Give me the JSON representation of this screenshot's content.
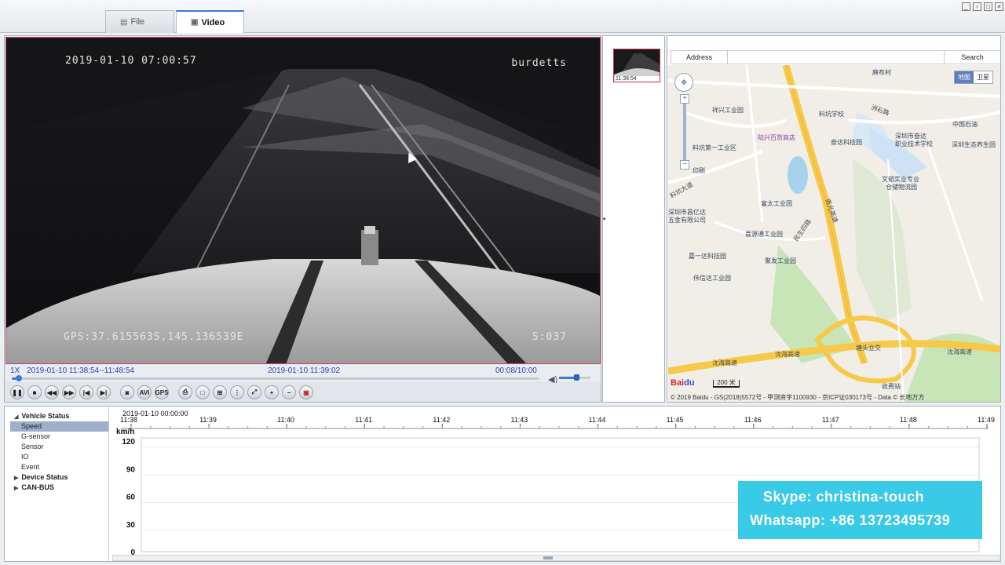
{
  "tabs": [
    {
      "label": "File",
      "icon": "file-icon"
    },
    {
      "label": "Video",
      "icon": "video-icon"
    }
  ],
  "window_controls": [
    "minimize-icon",
    "restore-icon",
    "maximize-icon",
    "close-icon"
  ],
  "video": {
    "osd_datetime": "2019-01-10 07:00:57",
    "osd_name": "burdetts",
    "osd_gps": "GPS:37.615563S,145.136539E",
    "osd_speed": "S:037",
    "playback_speed": "1X",
    "range": "2019-01-10 11:38:54--11:48:54",
    "current_time": "2019-01-10 11:39:02",
    "position": "00:08/10:00",
    "progress_fraction": 0.013,
    "volume_fraction": 0.55
  },
  "controls": [
    {
      "icon": "pause-icon",
      "glyph": "❚❚"
    },
    {
      "icon": "stop-icon",
      "glyph": "■"
    },
    {
      "icon": "rewind-icon",
      "glyph": "◀◀"
    },
    {
      "icon": "fast-forward-icon",
      "glyph": "▶▶"
    },
    {
      "icon": "previous-icon",
      "glyph": "|◀"
    },
    {
      "icon": "next-icon",
      "glyph": "▶|"
    },
    {
      "icon": "snapshot-icon",
      "glyph": "◙"
    },
    {
      "icon": "avi-icon",
      "glyph": "AVI"
    },
    {
      "icon": "gps-icon",
      "glyph": "GPS"
    },
    {
      "icon": "print-icon",
      "glyph": "⎙"
    },
    {
      "icon": "single-view-icon",
      "glyph": "□"
    },
    {
      "icon": "quad-view-icon",
      "glyph": "⊞"
    },
    {
      "icon": "nine-view-icon",
      "glyph": "⋮"
    },
    {
      "icon": "fullscreen-icon",
      "glyph": "⤢"
    },
    {
      "icon": "zoom-in-icon",
      "glyph": "+"
    },
    {
      "icon": "zoom-out-icon",
      "glyph": "−"
    },
    {
      "icon": "record-icon",
      "glyph": "▣"
    }
  ],
  "thumbnail": {
    "label": "11:38:54"
  },
  "map": {
    "address_label": "Address",
    "address_value": "",
    "search_label": "Search",
    "map_type": [
      "地图",
      "卫星"
    ],
    "places": [
      {
        "name": "麻布村",
        "cls": ""
      },
      {
        "name": "洲石路",
        "cls": "road"
      },
      {
        "name": "祥兴工业园",
        "cls": ""
      },
      {
        "name": "料坑学校",
        "cls": ""
      },
      {
        "name": "中国石油",
        "cls": ""
      },
      {
        "name": "陆兴百货商店",
        "cls": "purple"
      },
      {
        "name": "奋达科技园",
        "cls": ""
      },
      {
        "name": "深圳市奋达",
        "cls": ""
      },
      {
        "name": "职业技术学校",
        "cls": ""
      },
      {
        "name": "深圳生态养生园",
        "cls": ""
      },
      {
        "name": "料坑第一工业区",
        "cls": ""
      },
      {
        "name": "印刷",
        "cls": ""
      },
      {
        "name": "料坑大道",
        "cls": "road"
      },
      {
        "name": "文韬实业专业",
        "cls": ""
      },
      {
        "name": "仓储物流园",
        "cls": ""
      },
      {
        "name": "富太工业园",
        "cls": ""
      },
      {
        "name": "深圳市昌亿达",
        "cls": ""
      },
      {
        "name": "五金有限公司",
        "cls": ""
      },
      {
        "name": "喜源通工业园",
        "cls": ""
      },
      {
        "name": "民生四路",
        "cls": "road"
      },
      {
        "name": "嘉一达科技园",
        "cls": ""
      },
      {
        "name": "聚发工业园",
        "cls": ""
      },
      {
        "name": "伟信达工业园",
        "cls": ""
      },
      {
        "name": "南光高速",
        "cls": "road"
      },
      {
        "name": "塘头立交",
        "cls": ""
      },
      {
        "name": "沈海高速",
        "cls": "road"
      },
      {
        "name": "沈海高速",
        "cls": "road"
      },
      {
        "name": "沈海高速",
        "cls": "road"
      },
      {
        "name": "收费站",
        "cls": ""
      }
    ],
    "scale": "200 米",
    "copyright": "© 2019 Baidu - GS(2018)5572号 - 甲测资字1100930 - 京ICP证030173号 - Data © 长地万方"
  },
  "tree": [
    {
      "label": "Vehicle Status",
      "type": "group",
      "expanded": true
    },
    {
      "label": "Speed",
      "type": "child",
      "selected": true
    },
    {
      "label": "G-sensor",
      "type": "child"
    },
    {
      "label": "Sensor",
      "type": "child"
    },
    {
      "label": "IO",
      "type": "child"
    },
    {
      "label": "Event",
      "type": "child"
    },
    {
      "label": "Device Status",
      "type": "group",
      "expanded": false
    },
    {
      "label": "CAN-BUS",
      "type": "group",
      "expanded": false
    }
  ],
  "chart_data": {
    "type": "line",
    "title": "",
    "start_label": "2019-01-10 00:00:00",
    "x_ticks": [
      "11:38",
      "11:39",
      "11:40",
      "11:41",
      "11:42",
      "11:43",
      "11:44",
      "11:45",
      "11:46",
      "11:47",
      "11:48",
      "11:49"
    ],
    "xlabel": "",
    "ylabel": "km/h",
    "y_ticks": [
      120,
      90,
      60,
      30,
      0
    ],
    "ylim": [
      0,
      120
    ],
    "series": []
  },
  "promo": {
    "line1": "Skype: christina-touch",
    "line2": "Whatsapp: +86 13723495739"
  }
}
